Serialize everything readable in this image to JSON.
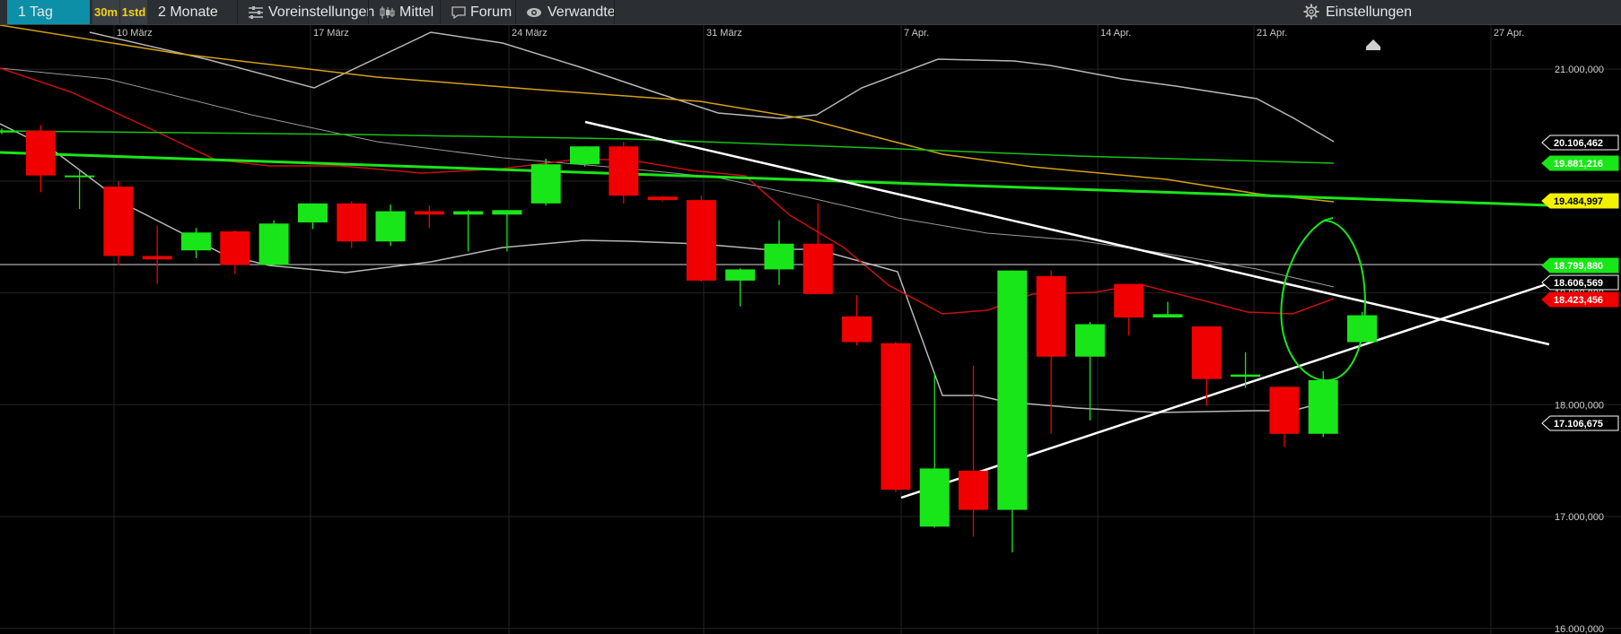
{
  "toolbar": {
    "range_label": "1 Tag",
    "interval_30m": "30m",
    "interval_1std": "1std",
    "period_label": "2 Monate",
    "presets_label": "Voreinstellungen",
    "mittel_label": "Mittel",
    "forum_label": "Forum",
    "related_label": "Verwandte",
    "settings_label": "Einstellungen",
    "colors": {
      "bar_bg": "#2b2f33",
      "active_bg": "#0e8fa8",
      "interval_text": "#f2d21b"
    }
  },
  "chart_data": {
    "type": "candlestick",
    "x_tick_labels": [
      "10 März",
      "17 März",
      "24 März",
      "31 März",
      "7 Apr.",
      "14 Apr.",
      "21 Apr.",
      "27 Apr."
    ],
    "y_tick_labels": [
      "21.000,000",
      "19.000,000",
      "18.000,000",
      "17.000,000",
      "16.000,000"
    ],
    "ylim": [
      15950,
      21250
    ],
    "grid": true,
    "colors": {
      "up": "#19e619",
      "down": "#f00000",
      "price_line": "#ffffff"
    },
    "candles": [
      {
        "o": 20450,
        "h": 20470,
        "l": 20420,
        "c": 20450
      },
      {
        "o": 20450,
        "h": 20500,
        "l": 19900,
        "c": 20050
      },
      {
        "o": 20050,
        "h": 20100,
        "l": 19750,
        "c": 20050
      },
      {
        "o": 19950,
        "h": 20000,
        "l": 19250,
        "c": 19330
      },
      {
        "o": 19330,
        "h": 19600,
        "l": 19080,
        "c": 19300
      },
      {
        "o": 19380,
        "h": 19580,
        "l": 19310,
        "c": 19540
      },
      {
        "o": 19550,
        "h": 19560,
        "l": 19170,
        "c": 19250
      },
      {
        "o": 19250,
        "h": 19650,
        "l": 19240,
        "c": 19620
      },
      {
        "o": 19630,
        "h": 19800,
        "l": 19570,
        "c": 19800
      },
      {
        "o": 19800,
        "h": 19820,
        "l": 19400,
        "c": 19460
      },
      {
        "o": 19460,
        "h": 19790,
        "l": 19420,
        "c": 19730
      },
      {
        "o": 19730,
        "h": 19780,
        "l": 19580,
        "c": 19700
      },
      {
        "o": 19700,
        "h": 19740,
        "l": 19370,
        "c": 19730
      },
      {
        "o": 19700,
        "h": 19740,
        "l": 19370,
        "c": 19740
      },
      {
        "o": 19800,
        "h": 20200,
        "l": 19780,
        "c": 20150
      },
      {
        "o": 20150,
        "h": 20310,
        "l": 20130,
        "c": 20310
      },
      {
        "o": 20310,
        "h": 20350,
        "l": 19800,
        "c": 19870
      },
      {
        "o": 19860,
        "h": 19870,
        "l": 19820,
        "c": 19830
      },
      {
        "o": 19830,
        "h": 19870,
        "l": 19100,
        "c": 19110
      },
      {
        "o": 19110,
        "h": 19220,
        "l": 18880,
        "c": 19210
      },
      {
        "o": 19210,
        "h": 19650,
        "l": 19070,
        "c": 19440
      },
      {
        "o": 19440,
        "h": 19800,
        "l": 18990,
        "c": 18990
      },
      {
        "o": 18790,
        "h": 18980,
        "l": 18530,
        "c": 18560
      },
      {
        "o": 18550,
        "h": 18560,
        "l": 17220,
        "c": 17240
      },
      {
        "o": 16910,
        "h": 18280,
        "l": 16900,
        "c": 17430
      },
      {
        "o": 17410,
        "h": 18350,
        "l": 16820,
        "c": 17060
      },
      {
        "o": 17060,
        "h": 19200,
        "l": 16680,
        "c": 19200
      },
      {
        "o": 19150,
        "h": 19200,
        "l": 17740,
        "c": 18430
      },
      {
        "o": 18430,
        "h": 18740,
        "l": 17860,
        "c": 18720
      },
      {
        "o": 19080,
        "h": 19080,
        "l": 18620,
        "c": 18780
      },
      {
        "o": 18780,
        "h": 18920,
        "l": 18780,
        "c": 18810
      },
      {
        "o": 18700,
        "h": 18700,
        "l": 17990,
        "c": 18230
      },
      {
        "o": 18250,
        "h": 18470,
        "l": 18150,
        "c": 18270
      },
      {
        "o": 18160,
        "h": 18160,
        "l": 17620,
        "c": 17740
      },
      {
        "o": 17740,
        "h": 18300,
        "l": 17710,
        "c": 18220
      },
      {
        "o": 18560,
        "h": 18830,
        "l": 18560,
        "c": 18800
      }
    ],
    "price_labels": [
      {
        "text": "20.106,462",
        "bg": "#000000",
        "fg": "#ffffff",
        "border": "#ffffff"
      },
      {
        "text": "19.881,216",
        "bg": "#19e619",
        "fg": "#ffffff",
        "border": "#19e619"
      },
      {
        "text": "19.484,997",
        "bg": "#f2f200",
        "fg": "#000000",
        "border": "#f2f200"
      },
      {
        "text": "18.799,880",
        "bg": "#19e619",
        "fg": "#ffffff",
        "border": "#19e619"
      },
      {
        "text": "18.606,569",
        "bg": "#000000",
        "fg": "#ffffff",
        "border": "#ffffff"
      },
      {
        "text": "18.423,456",
        "bg": "#f00000",
        "fg": "#ffffff",
        "border": "#f00000"
      },
      {
        "text": "17.106,675",
        "bg": "#000000",
        "fg": "#ffffff",
        "border": "#ffffff"
      }
    ]
  }
}
